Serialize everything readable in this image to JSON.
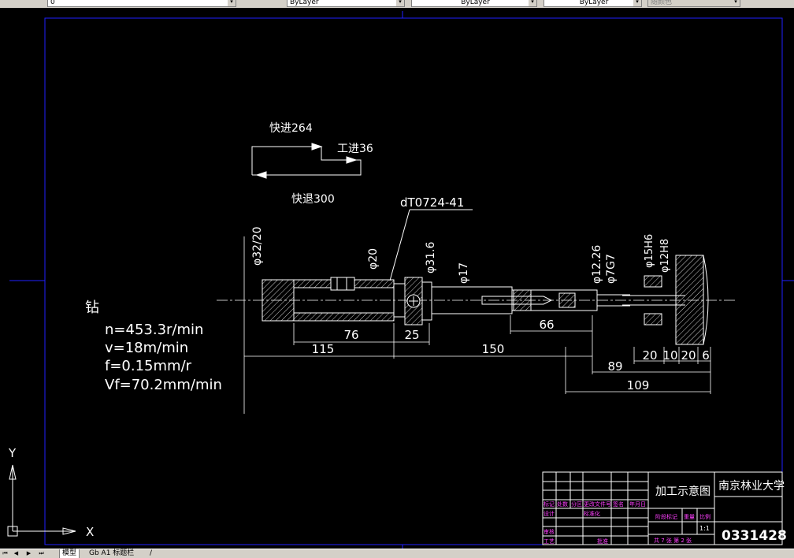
{
  "toolbar": {
    "layer_value": "0",
    "color_value": "ByLayer",
    "linetype_value": "ByLayer",
    "lineweight_value": "ByLayer",
    "plotstyle_value": "随颜色"
  },
  "drawing": {
    "feed_fast_in": "快进264",
    "feed_work": "工进36",
    "feed_fast_out": "快退300",
    "part_code": "dT0724-41",
    "dia_32_20": "φ32/20",
    "dia_20": "φ20",
    "dia_31_6": "φ31.6",
    "dia_17": "φ17",
    "dia_12_26": "φ12.26",
    "dia_7g7": "φ7G7",
    "dia_15": "φ15H6",
    "dia_12": "φ12H8",
    "dim_76": "76",
    "dim_25": "25",
    "dim_115": "115",
    "dim_150": "150",
    "dim_66": "66",
    "dim_89": "89",
    "dim_20a": "20",
    "dim_10": "10",
    "dim_20b": "20",
    "dim_6": "6",
    "dim_109": "109",
    "process_label": "钻",
    "param_n": "n=453.3r/min",
    "param_v": "v=18m/min",
    "param_f": "f=0.15mm/r",
    "param_vf": "Vf=70.2mm/min"
  },
  "title_block": {
    "drawing_title": "加工示意图",
    "school": "南京林业大学",
    "drawing_number": "0331428",
    "scale": "1:1",
    "sheet_info": "共 7 张 第 2 张",
    "row_labels": [
      "标记",
      "处数",
      "分区",
      "更改文件号",
      "签名",
      "年月日"
    ],
    "design_label": "设计",
    "standard_label": "标准化",
    "review_label": "审核",
    "process_label": "工艺",
    "approve_label": "批准",
    "stage_label": "阶段标记",
    "weight_label": "重量",
    "ratio_label": "比例"
  },
  "ucs": {
    "y_label": "Y",
    "x_label": "X"
  },
  "status": {
    "tabs": [
      "模型",
      "Gb A1 标题栏",
      "/"
    ]
  },
  "colors": {
    "background": "#000000",
    "frame": "#2020ff",
    "geometry": "#ffffff",
    "title_block_text": "#ff40ff"
  }
}
